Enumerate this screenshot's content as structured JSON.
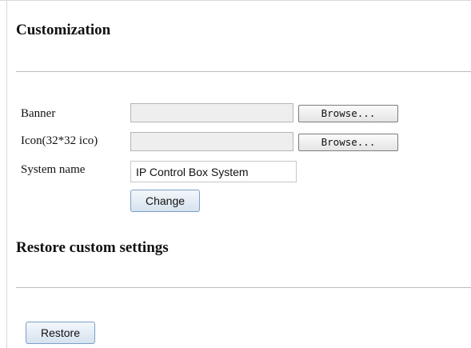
{
  "customization": {
    "title": "Customization",
    "banner_label": "Banner",
    "icon_label": "Icon(32*32 ico)",
    "system_name_label": "System name",
    "system_name_value": "IP Control Box System",
    "browse_label": "Browse...",
    "change_label": "Change"
  },
  "restore": {
    "title": "Restore custom settings",
    "button_label": "Restore"
  }
}
